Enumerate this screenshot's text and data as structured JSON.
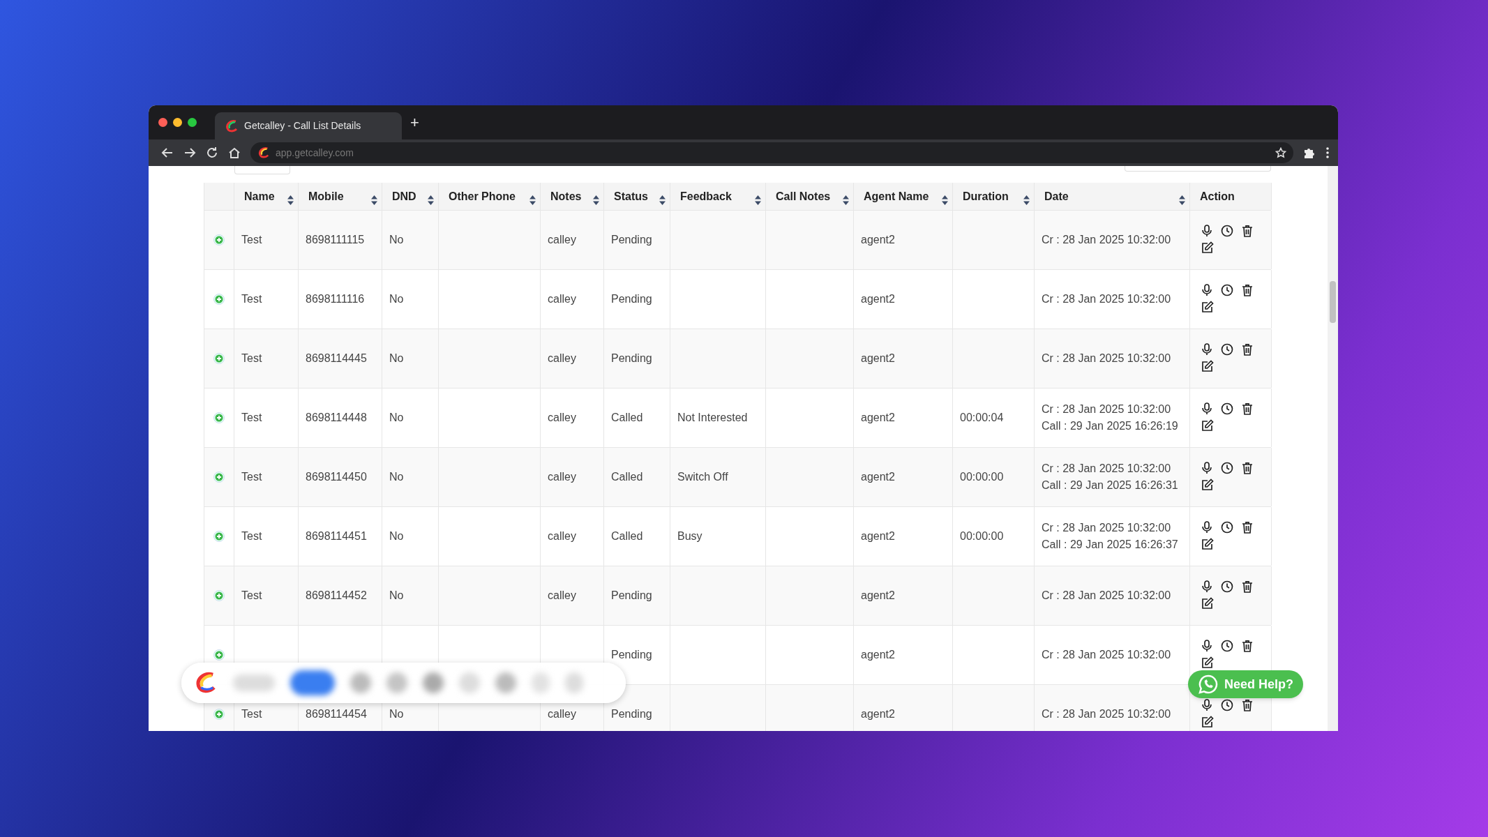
{
  "browser": {
    "tab_title": "Getcalley - Call List Details",
    "new_tab": "+",
    "url": "app.getcalley.com"
  },
  "table": {
    "columns": [
      {
        "sortable": false
      },
      {
        "label": "Name",
        "sortable": true
      },
      {
        "label": "Mobile",
        "sortable": true
      },
      {
        "label": "DND",
        "sortable": true
      },
      {
        "label": "Other Phone",
        "sortable": true
      },
      {
        "label": "Notes",
        "sortable": true
      },
      {
        "label": "Status",
        "sortable": true
      },
      {
        "label": "Feedback",
        "sortable": true
      },
      {
        "label": "Call Notes",
        "sortable": true
      },
      {
        "label": "Agent Name",
        "sortable": true
      },
      {
        "label": "Duration",
        "sortable": true
      },
      {
        "label": "Date",
        "sortable": true
      },
      {
        "label": "Action",
        "sortable": false
      }
    ],
    "rows": [
      {
        "name": "Test",
        "mobile": "8698111115",
        "dnd": "No",
        "notes": "calley",
        "status": "Pending",
        "agent": "agent2",
        "date": [
          "Cr : 28 Jan 2025 10:32:00"
        ]
      },
      {
        "name": "Test",
        "mobile": "8698111116",
        "dnd": "No",
        "notes": "calley",
        "status": "Pending",
        "agent": "agent2",
        "date": [
          "Cr : 28 Jan 2025 10:32:00"
        ]
      },
      {
        "name": "Test",
        "mobile": "8698114445",
        "dnd": "No",
        "notes": "calley",
        "status": "Pending",
        "agent": "agent2",
        "date": [
          "Cr : 28 Jan 2025 10:32:00"
        ]
      },
      {
        "name": "Test",
        "mobile": "8698114448",
        "dnd": "No",
        "notes": "calley",
        "status": "Called",
        "feedback": "Not Interested",
        "agent": "agent2",
        "duration": "00:00:04",
        "date": [
          "Cr : 28 Jan 2025 10:32:00",
          "Call : 29 Jan 2025 16:26:19"
        ]
      },
      {
        "name": "Test",
        "mobile": "8698114450",
        "dnd": "No",
        "notes": "calley",
        "status": "Called",
        "feedback": "Switch Off",
        "agent": "agent2",
        "duration": "00:00:00",
        "date": [
          "Cr : 28 Jan 2025 10:32:00",
          "Call : 29 Jan 2025 16:26:31"
        ]
      },
      {
        "name": "Test",
        "mobile": "8698114451",
        "dnd": "No",
        "notes": "calley",
        "status": "Called",
        "feedback": "Busy",
        "agent": "agent2",
        "duration": "00:00:00",
        "date": [
          "Cr : 28 Jan 2025 10:32:00",
          "Call : 29 Jan 2025 16:26:37"
        ]
      },
      {
        "name": "Test",
        "mobile": "8698114452",
        "dnd": "No",
        "notes": "calley",
        "status": "Pending",
        "agent": "agent2",
        "date": [
          "Cr : 28 Jan 2025 10:32:00"
        ]
      },
      {
        "status": "Pending",
        "agent": "agent2",
        "date": [
          "Cr : 28 Jan 2025 10:32:00"
        ]
      },
      {
        "name": "Test",
        "mobile": "8698114454",
        "dnd": "No",
        "notes": "calley",
        "status": "Pending",
        "agent": "agent2",
        "date": [
          "Cr : 28 Jan 2025 10:32:00"
        ]
      }
    ]
  },
  "help_button": {
    "label": "Need Help?"
  }
}
